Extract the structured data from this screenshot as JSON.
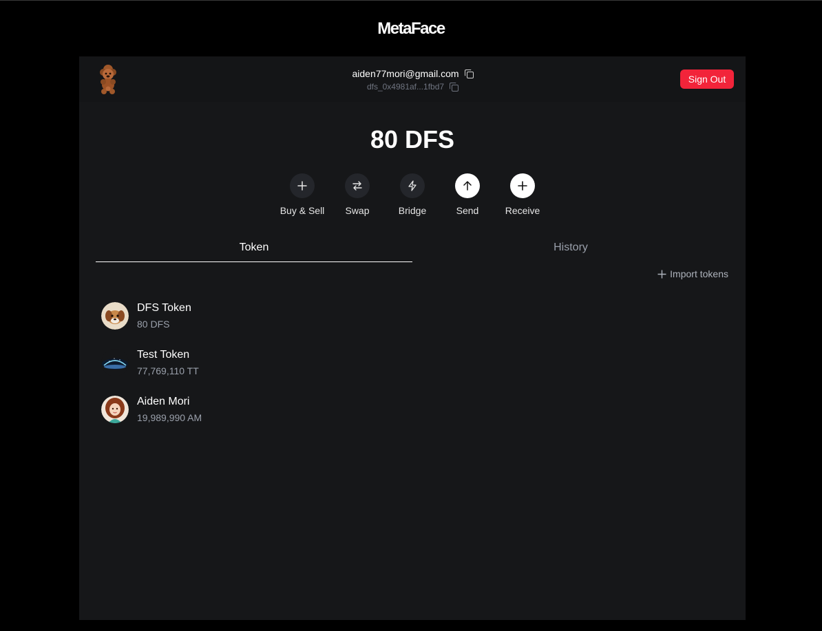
{
  "app": {
    "brand": "MetaFace"
  },
  "header": {
    "email": "aiden77mori@gmail.com",
    "address": "dfs_0x4981af...1fbd7",
    "sign_out_label": "Sign Out"
  },
  "balance": {
    "label": "80 DFS"
  },
  "actions": [
    {
      "label": "Buy & Sell",
      "icon": "plus-icon"
    },
    {
      "label": "Swap",
      "icon": "swap-arrows-icon"
    },
    {
      "label": "Bridge",
      "icon": "lightning-icon"
    },
    {
      "label": "Send",
      "icon": "arrow-up-icon"
    },
    {
      "label": "Receive",
      "icon": "plus-icon"
    }
  ],
  "tabs": [
    {
      "label": "Token",
      "active": true
    },
    {
      "label": "History",
      "active": false
    }
  ],
  "import_tokens_label": "Import tokens",
  "tokens": [
    {
      "name": "DFS Token",
      "amount": "80 DFS"
    },
    {
      "name": "Test Token",
      "amount": "77,769,110 TT"
    },
    {
      "name": "Aiden Mori",
      "amount": "19,989,990 AM"
    }
  ],
  "colors": {
    "background": "#000000",
    "panel": "#161719",
    "accent_red": "#f2243a",
    "muted_text": "#9aa0ab"
  }
}
